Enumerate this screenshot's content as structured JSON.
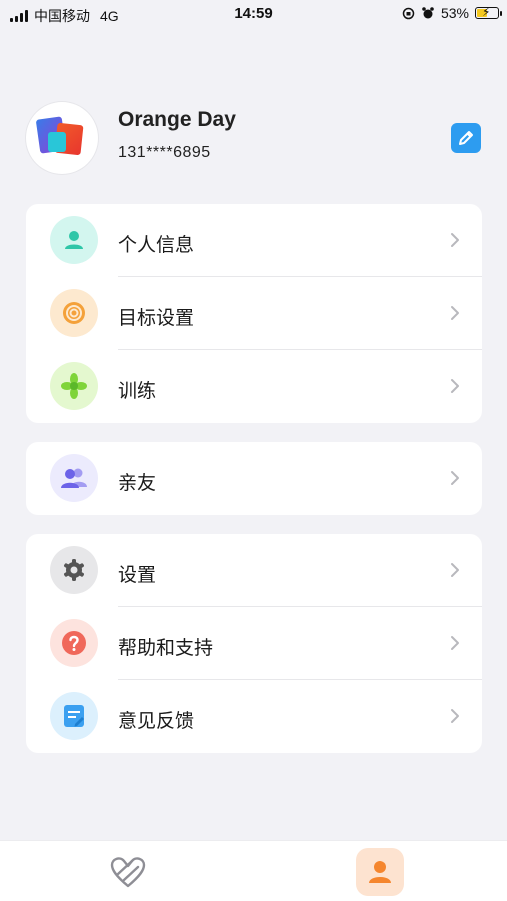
{
  "status_bar": {
    "carrier": "中国移动",
    "network": "4G",
    "time": "14:59",
    "battery_percent": "53%",
    "battery_level": 0.53,
    "icons": [
      "signal-icon",
      "orientation-lock-icon",
      "alarm-icon",
      "battery-icon"
    ]
  },
  "profile": {
    "name": "Orange Day",
    "phone": "131****6895",
    "edit_icon": "pencil-icon"
  },
  "groups": [
    {
      "items": [
        {
          "label": "个人信息",
          "icon": "person-icon",
          "icon_bg": "#d3f6ef",
          "icon_color": "#2fc6a8"
        },
        {
          "label": "目标设置",
          "icon": "target-icon",
          "icon_bg": "#fde9cf",
          "icon_color": "#f4a13a"
        },
        {
          "label": "训练",
          "icon": "flower-icon",
          "icon_bg": "#e4f8cf",
          "icon_color": "#7fd43a"
        }
      ]
    },
    {
      "items": [
        {
          "label": "亲友",
          "icon": "group-icon",
          "icon_bg": "#ecebfd",
          "icon_color": "#6c63e8"
        }
      ]
    },
    {
      "items": [
        {
          "label": "设置",
          "icon": "gear-icon",
          "icon_bg": "#e7e7e9",
          "icon_color": "#555555"
        },
        {
          "label": "帮助和支持",
          "icon": "question-icon",
          "icon_bg": "#fde3de",
          "icon_color": "#f0685a"
        },
        {
          "label": "意见反馈",
          "icon": "feedback-icon",
          "icon_bg": "#dcf0fd",
          "icon_color": "#3ba0f0"
        }
      ]
    }
  ],
  "tabbar": {
    "tabs": [
      {
        "icon": "heart-outline-icon",
        "active": false
      },
      {
        "icon": "person-icon",
        "active": true
      }
    ],
    "accent": "#f5862e"
  }
}
